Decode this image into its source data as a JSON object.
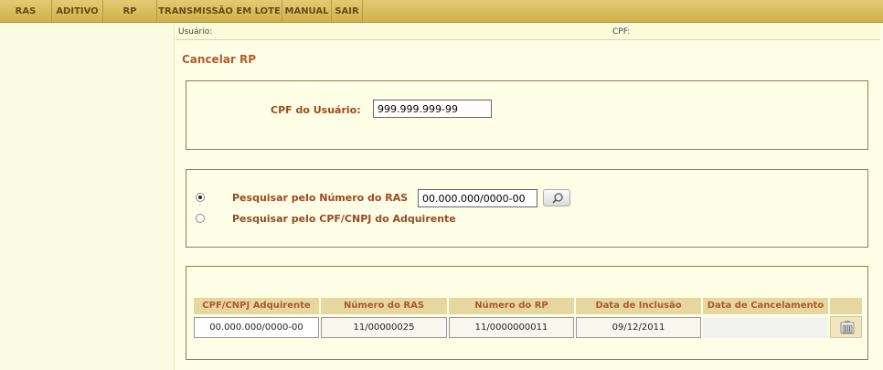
{
  "menu": {
    "items": [
      "RAS",
      "ADITIVO",
      "RP",
      "TRANSMISSÃO EM LOTE",
      "MANUAL",
      "SAIR"
    ]
  },
  "userbar": {
    "usuario_label": "Usuário:",
    "cpf_label": "CPF:"
  },
  "page": {
    "title": "Cancelar RP"
  },
  "cpf_section": {
    "label": "CPF do Usuário:",
    "value": "999.999.999-99"
  },
  "search_section": {
    "option1_label": "Pesquisar pelo Número do RAS",
    "option1_value": "00.000.000/0000-00",
    "option1_selected": true,
    "option2_label": "Pesquisar pelo CPF/CNPJ do Adquirente",
    "search_icon": "magnifier-icon"
  },
  "table": {
    "headers": [
      "CPF/CNPJ Adquirente",
      "Número do RAS",
      "Número do RP",
      "Data de Inclusão",
      "Data de Cancelamento",
      ""
    ],
    "rows": [
      {
        "cpf_cnpj": "00.000.000/0000-00",
        "numero_ras": "11/00000025",
        "numero_rp": "11/0000000011",
        "data_inclusao": "09/12/2011",
        "data_cancelamento": "",
        "action_icon": "trash-icon"
      }
    ]
  },
  "colors": {
    "menu_bg": "#d9bc5e",
    "label_color": "#9c4a22",
    "title_color": "#b55b2b",
    "page_bg": "#fefee6"
  }
}
